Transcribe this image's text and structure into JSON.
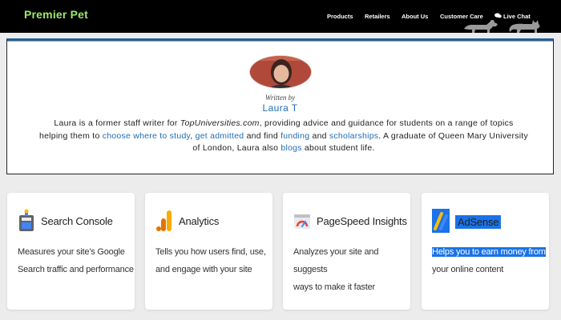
{
  "brand": {
    "name": "Premier Pet",
    "accent": "#9ee86a"
  },
  "nav": {
    "items": [
      "Products",
      "Retailers",
      "About Us",
      "Customer Care"
    ],
    "live_chat": "Live Chat"
  },
  "author": {
    "written_by": "Written by",
    "name": "Laura T",
    "bio": {
      "s1": "Laura is a former staff writer for ",
      "site": "TopUniversities.com",
      "s2": ", providing advice and guidance for students on a range of topics helping them to ",
      "link1": "choose where to study",
      "s3": ", ",
      "link2": "get admitted",
      "s4": " and find ",
      "link3": "funding",
      "s5": " and ",
      "link4": "scholarships",
      "s6": ". A graduate of Queen Mary University of London, Laura also ",
      "link5": "blogs",
      "s7": " about student life."
    }
  },
  "cards": [
    {
      "title": "Search Console",
      "desc_l1": "Measures your site's Google",
      "desc_l2": "Search traffic and performance",
      "icon": "search-console-icon"
    },
    {
      "title": "Analytics",
      "desc_l1": "Tells you how users find, use,",
      "desc_l2": "and engage with your site",
      "icon": "analytics-icon"
    },
    {
      "title": "PageSpeed Insights",
      "desc_l1": "Analyzes your site and suggests",
      "desc_l2": "ways to make it faster",
      "icon": "pagespeed-icon"
    },
    {
      "title": "AdSense",
      "desc_l1": "Helps you to earn money from",
      "desc_l2": "your online content",
      "icon": "adsense-icon"
    }
  ],
  "colors": {
    "link": "#1f6db5",
    "highlight": "#1a73e8",
    "topbar": "#000000"
  }
}
